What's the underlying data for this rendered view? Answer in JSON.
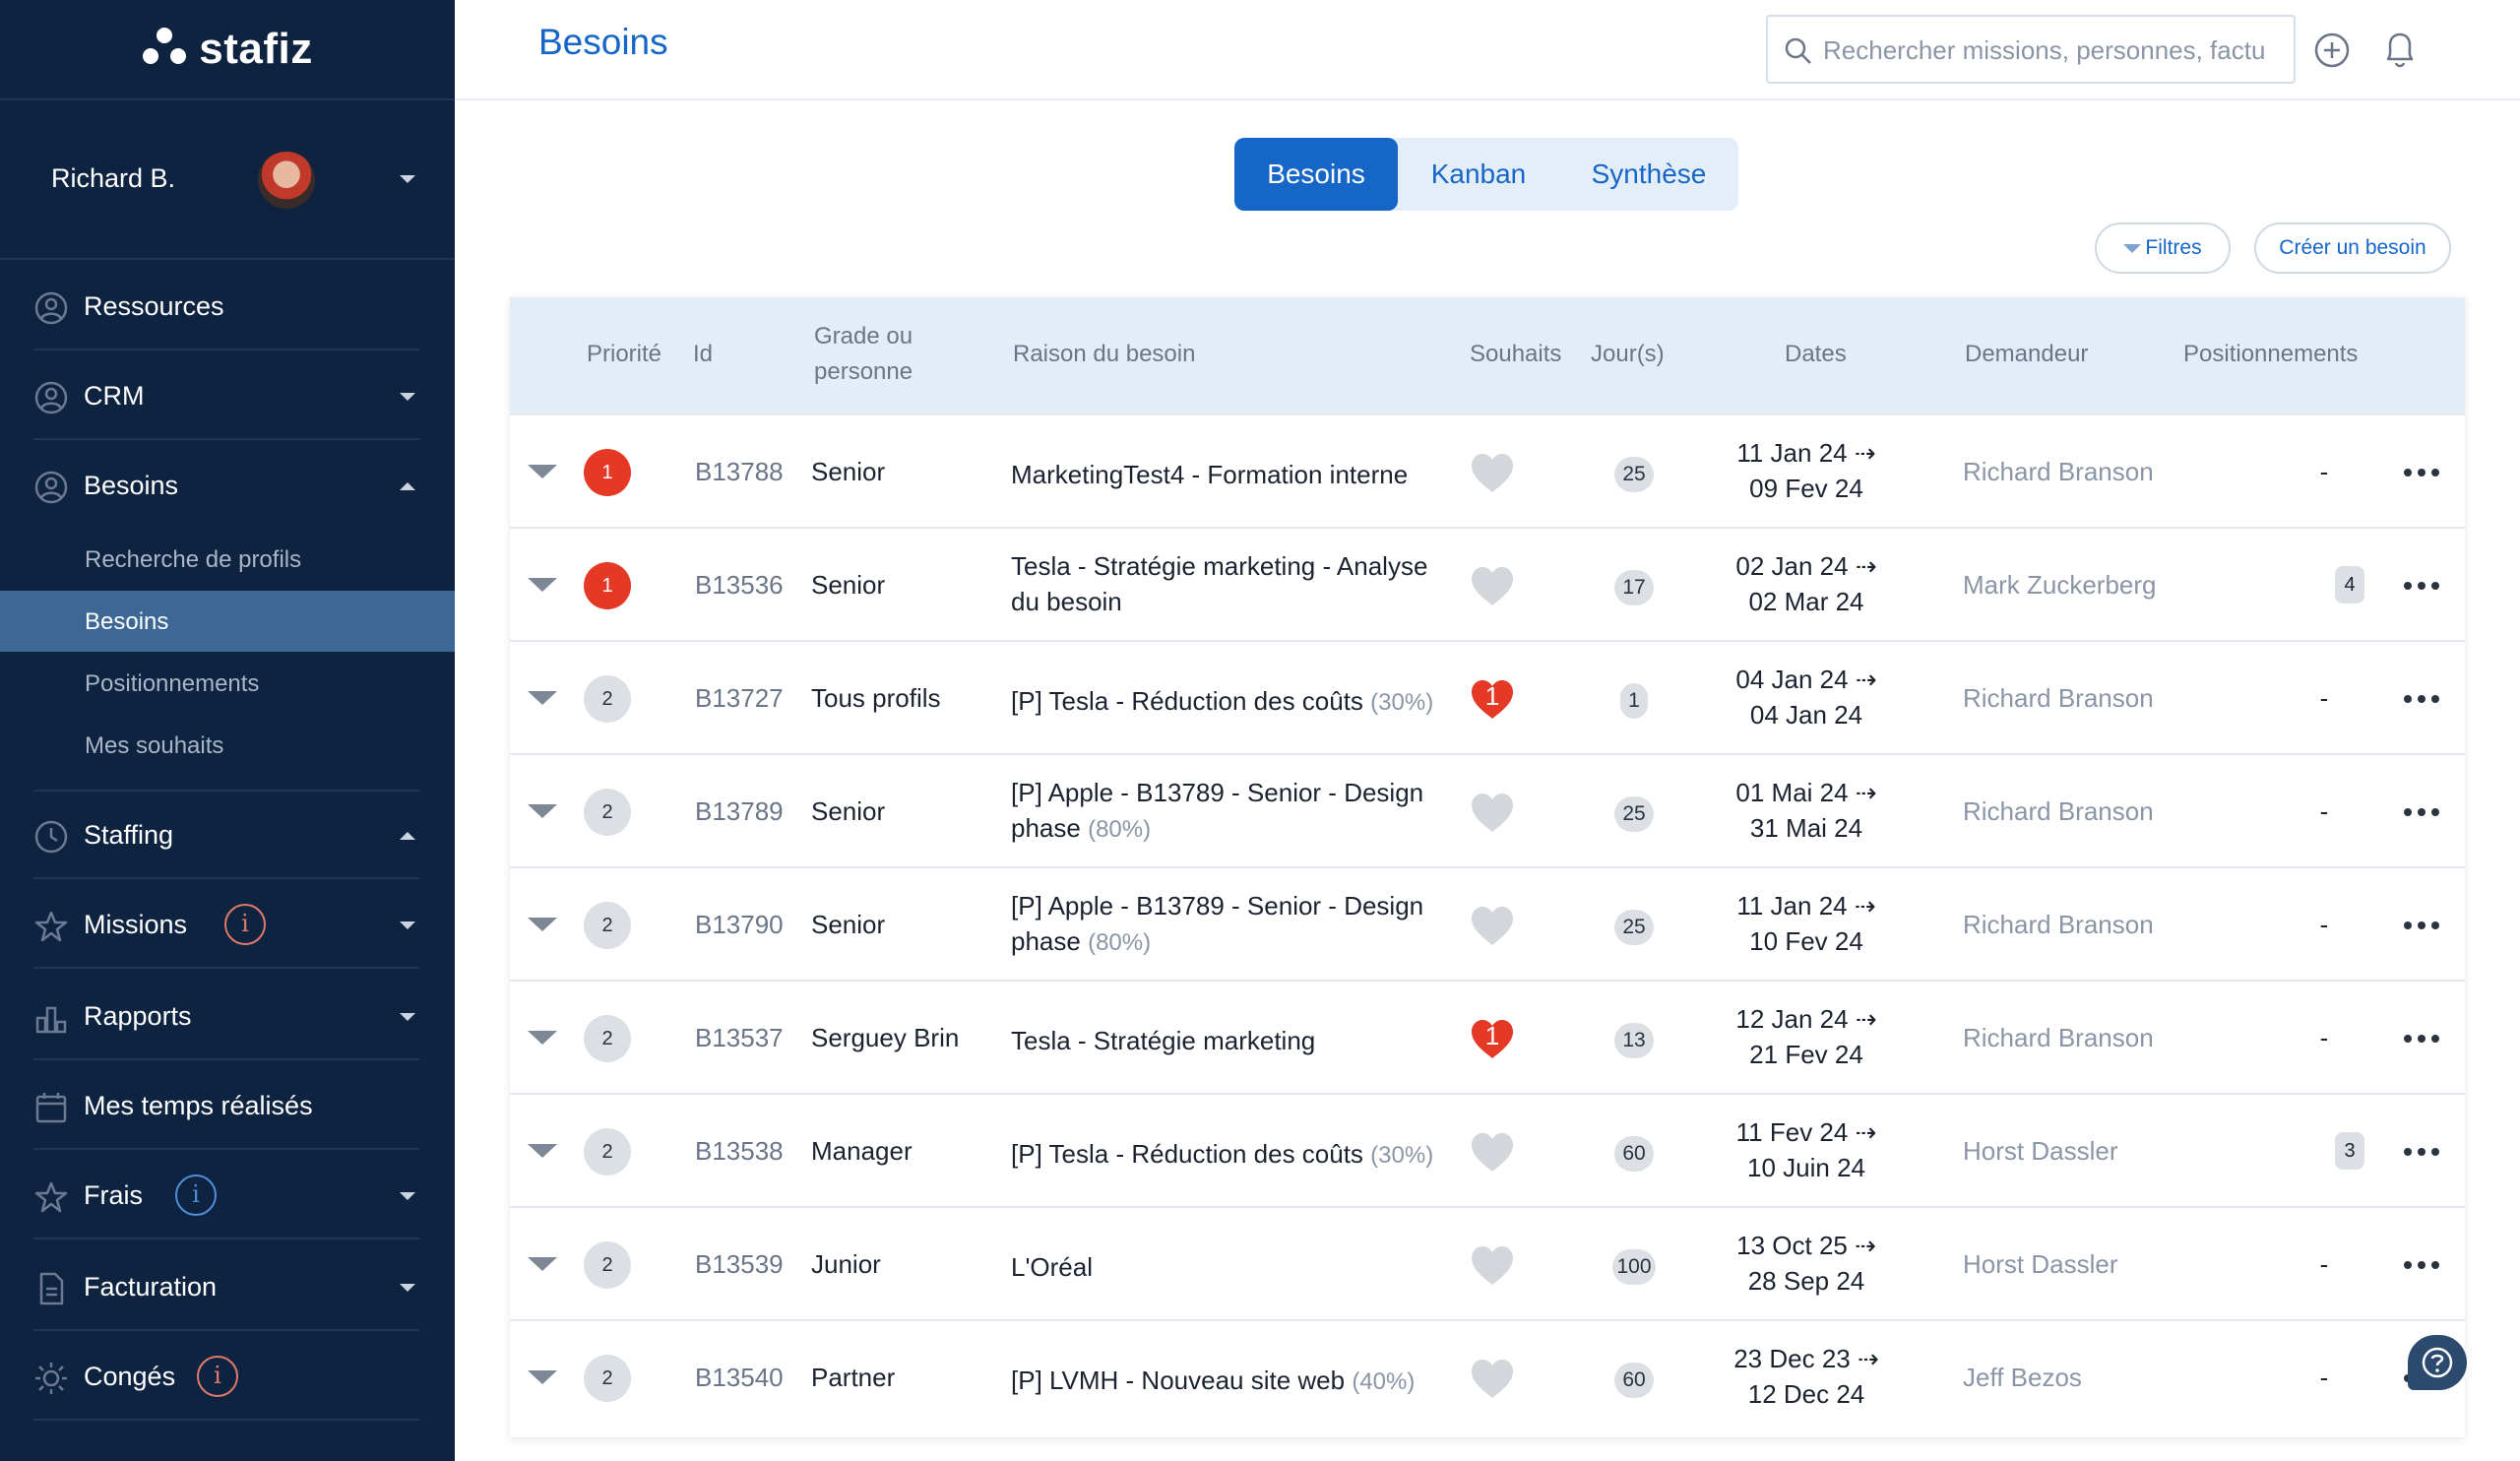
{
  "app": {
    "logo_text": "stafiz"
  },
  "user": {
    "name": "Richard B."
  },
  "sidebar": {
    "items": [
      {
        "label": "Ressources"
      },
      {
        "label": "CRM"
      },
      {
        "label": "Besoins"
      },
      {
        "label": "Staffing"
      },
      {
        "label": "Missions"
      },
      {
        "label": "Rapports"
      },
      {
        "label": "Mes temps réalisés"
      },
      {
        "label": "Frais"
      },
      {
        "label": "Facturation"
      },
      {
        "label": "Congés"
      }
    ],
    "subitems": [
      {
        "label": "Recherche de profils"
      },
      {
        "label": "Besoins"
      },
      {
        "label": "Positionnements"
      },
      {
        "label": "Mes souhaits"
      }
    ],
    "info_glyph": "i"
  },
  "header": {
    "title": "Besoins",
    "search_placeholder": "Rechercher missions, personnes, factu"
  },
  "tabs": [
    {
      "label": "Besoins"
    },
    {
      "label": "Kanban"
    },
    {
      "label": "Synthèse"
    }
  ],
  "actions": {
    "filters": "Filtres",
    "create": "Créer un besoin"
  },
  "table": {
    "headers": {
      "priorite": "Priorité",
      "id": "Id",
      "grade_l1": "Grade ou",
      "grade_l2": "personne",
      "raison": "Raison du besoin",
      "souhaits": "Souhaits",
      "jours": "Jour(s)",
      "dates": "Dates",
      "demandeur": "Demandeur",
      "positionnements": "Positionnements"
    },
    "rows": [
      {
        "priority": "1",
        "id": "B13788",
        "grade": "Senior",
        "raison_l1": "MarketingTest4 - Formation interne",
        "raison_l2": "",
        "pct": "",
        "souhait": "",
        "days": "25",
        "date1": "11 Jan 24 ⇢",
        "date2": "09 Fev 24",
        "demandeur": "Richard Branson",
        "pos": "-"
      },
      {
        "priority": "1",
        "id": "B13536",
        "grade": "Senior",
        "raison_l1": "Tesla - Stratégie marketing - Analyse",
        "raison_l2": "du besoin",
        "pct": "",
        "souhait": "",
        "days": "17",
        "date1": "02 Jan 24 ⇢",
        "date2": "02 Mar 24",
        "demandeur": "Mark Zuckerberg",
        "pos": "4"
      },
      {
        "priority": "2",
        "id": "B13727",
        "grade": "Tous profils",
        "raison_l1": "[P] Tesla - Réduction des coûts",
        "raison_l2": "",
        "pct": "(30%)",
        "souhait": "1",
        "days": "1",
        "date1": "04 Jan 24 ⇢",
        "date2": "04 Jan 24",
        "demandeur": "Richard Branson",
        "pos": "-"
      },
      {
        "priority": "2",
        "id": "B13789",
        "grade": "Senior",
        "raison_l1": "[P] Apple - B13789 - Senior - Design",
        "raison_l2": "phase",
        "pct": "(80%)",
        "souhait": "",
        "days": "25",
        "date1": "01 Mai 24 ⇢",
        "date2": "31 Mai 24",
        "demandeur": "Richard Branson",
        "pos": "-"
      },
      {
        "priority": "2",
        "id": "B13790",
        "grade": "Senior",
        "raison_l1": "[P] Apple - B13789 - Senior - Design",
        "raison_l2": "phase",
        "pct": "(80%)",
        "souhait": "",
        "days": "25",
        "date1": "11 Jan 24 ⇢",
        "date2": "10 Fev 24",
        "demandeur": "Richard Branson",
        "pos": "-"
      },
      {
        "priority": "2",
        "id": "B13537",
        "grade": "Serguey Brin",
        "raison_l1": "Tesla - Stratégie marketing",
        "raison_l2": "",
        "pct": "",
        "souhait": "1",
        "days": "13",
        "date1": "12 Jan 24 ⇢",
        "date2": "21 Fev 24",
        "demandeur": "Richard Branson",
        "pos": "-"
      },
      {
        "priority": "2",
        "id": "B13538",
        "grade": "Manager",
        "raison_l1": "[P] Tesla - Réduction des coûts",
        "raison_l2": "",
        "pct": "(30%)",
        "souhait": "",
        "days": "60",
        "date1": "11 Fev 24 ⇢",
        "date2": "10 Juin 24",
        "demandeur": "Horst Dassler",
        "pos": "3"
      },
      {
        "priority": "2",
        "id": "B13539",
        "grade": "Junior",
        "raison_l1": "L'Oréal",
        "raison_l2": "",
        "pct": "",
        "souhait": "",
        "days": "100",
        "date1": "13 Oct 25 ⇢",
        "date2": "28 Sep 24",
        "demandeur": "Horst Dassler",
        "pos": "-"
      },
      {
        "priority": "2",
        "id": "B13540",
        "grade": "Partner",
        "raison_l1": "[P] LVMH - Nouveau site web",
        "raison_l2": "",
        "pct": "(40%)",
        "souhait": "",
        "days": "60",
        "date1": "23 Dec 23 ⇢",
        "date2": "12 Dec 24",
        "demandeur": "Jeff Bezos",
        "pos": "-"
      }
    ]
  },
  "colors": {
    "sidebar_bg": "#0d2340",
    "accent": "#1566c7",
    "priority_high": "#e53825",
    "heart_active": "#e53825",
    "heart_inactive": "#d3d6da"
  }
}
